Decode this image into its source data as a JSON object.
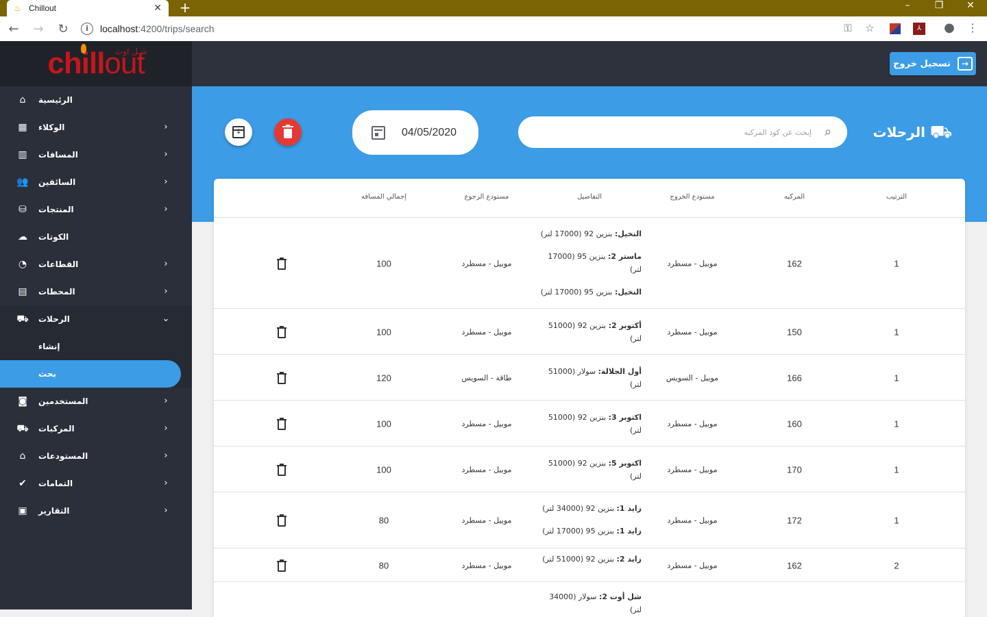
{
  "browser": {
    "tab_title": "Chillout",
    "url_host": "localhost",
    "url_rest": ":4200/trips/search"
  },
  "logo": {
    "chill": "chill",
    "out": "out",
    "arabic": "شـل اوت"
  },
  "sidebar": {
    "items": [
      {
        "label": "الرئيسية",
        "icon": "home-icon",
        "glyph": "⌂",
        "has_children": false
      },
      {
        "label": "الوكلاء",
        "icon": "agents-icon",
        "glyph": "▦",
        "has_children": true
      },
      {
        "label": "المسافات",
        "icon": "map-icon",
        "glyph": "▥",
        "has_children": true
      },
      {
        "label": "السائقين",
        "icon": "people-icon",
        "glyph": "👥",
        "has_children": true
      },
      {
        "label": "المنتجات",
        "icon": "products-icon",
        "glyph": "⛁",
        "has_children": true
      },
      {
        "label": "الكوتات",
        "icon": "cloud-icon",
        "glyph": "☁",
        "has_children": false
      },
      {
        "label": "القطاعات",
        "icon": "sectors-icon",
        "glyph": "◔",
        "has_children": true
      },
      {
        "label": "المحطات",
        "icon": "stations-icon",
        "glyph": "▤",
        "has_children": true
      },
      {
        "label": "الرحلات",
        "icon": "trips-icon",
        "glyph": "⛟",
        "has_children": true,
        "open": true
      },
      {
        "label": "المستخدمين",
        "icon": "users-icon",
        "glyph": "◙",
        "has_children": true
      },
      {
        "label": "المركبات",
        "icon": "truck-icon",
        "glyph": "⛟",
        "has_children": true
      },
      {
        "label": "المستودعات",
        "icon": "warehouse-icon",
        "glyph": "⌂",
        "has_children": true
      },
      {
        "label": "التمامات",
        "icon": "check-icon",
        "glyph": "✔",
        "has_children": true
      },
      {
        "label": "التقارير",
        "icon": "reports-icon",
        "glyph": "▣",
        "has_children": true
      }
    ],
    "trips_sub": [
      {
        "label": "إنشاء",
        "active": false
      },
      {
        "label": "بحث",
        "active": true
      }
    ]
  },
  "header": {
    "logout_label": "تسجيل خروج"
  },
  "page": {
    "title": "الرحلات",
    "search_placeholder": "إبحث عن كود المركبه",
    "date": "04/05/2020"
  },
  "table": {
    "headers": {
      "order": "الترتيب",
      "vehicle": "المركبه",
      "exit_depot": "مستودع الخروج",
      "details": "التفاصيل",
      "return_depot": "مستودع الرجوع",
      "total_distance": "إجمالي المسافه"
    },
    "rows": [
      {
        "order": "1",
        "vehicle": "162",
        "exit_depot": "موبيل - مسطرد",
        "return_depot": "موبيل - مسطرد",
        "distance": "100",
        "details": [
          {
            "station": "النخيل:",
            "text": " بنزين 92 (17000 لتر)"
          },
          {
            "station": "ماستر 2:",
            "text": " بنزين 95 (17000 لتر)"
          },
          {
            "station": "النخيل:",
            "text": " بنزين 95 (17000 لتر)"
          }
        ]
      },
      {
        "order": "1",
        "vehicle": "150",
        "exit_depot": "موبيل - مسطرد",
        "return_depot": "موبيل - مسطرد",
        "distance": "100",
        "details": [
          {
            "station": "أكتوبر 2:",
            "text": " بنزين 92 (51000 لتر)"
          }
        ]
      },
      {
        "order": "1",
        "vehicle": "166",
        "exit_depot": "موبيل - السويس",
        "return_depot": "طاقة - السويس",
        "distance": "120",
        "details": [
          {
            "station": "أول الجلالة:",
            "text": " سولار (51000 لتر)"
          }
        ]
      },
      {
        "order": "1",
        "vehicle": "160",
        "exit_depot": "موبيل - مسطرد",
        "return_depot": "موبيل - مسطرد",
        "distance": "100",
        "details": [
          {
            "station": "اكتوبر 3:",
            "text": " بنزين 92 (51000 لتر)"
          }
        ]
      },
      {
        "order": "1",
        "vehicle": "170",
        "exit_depot": "موبيل - مسطرد",
        "return_depot": "موبيل - مسطرد",
        "distance": "100",
        "details": [
          {
            "station": "اكتوبر 5:",
            "text": " بنزين 92 (51000 لتر)"
          }
        ]
      },
      {
        "order": "1",
        "vehicle": "172",
        "exit_depot": "موبيل - مسطرد",
        "return_depot": "موبيل - مسطرد",
        "distance": "80",
        "details": [
          {
            "station": "زايد 1:",
            "text": " بنزين 92 (34000 لتر)"
          },
          {
            "station": "زايد 1:",
            "text": " بنزين 95 (17000 لتر)"
          }
        ]
      },
      {
        "order": "2",
        "vehicle": "162",
        "exit_depot": "موبيل - مسطرد",
        "return_depot": "موبيل - مسطرد",
        "distance": "80",
        "details": [
          {
            "station": "زايد 2:",
            "text": " بنزين 92 (51000 لتر)"
          }
        ]
      },
      {
        "order": "",
        "vehicle": "",
        "exit_depot": "",
        "return_depot": "",
        "distance": "",
        "details": [
          {
            "station": "شل أوت 2:",
            "text": " سولار (34000 لتر)"
          }
        ]
      }
    ]
  }
}
